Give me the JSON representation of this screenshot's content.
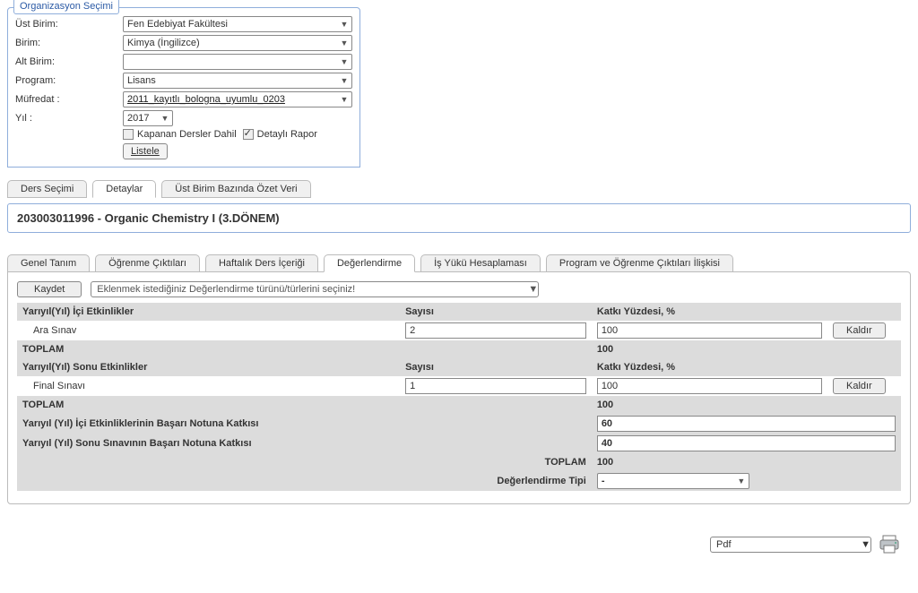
{
  "org": {
    "legend": "Organizasyon Seçimi",
    "labels": {
      "ust_birim": "Üst Birim:",
      "birim": "Birim:",
      "alt_birim": "Alt Birim:",
      "program": "Program:",
      "muferdat": "Müfredat :",
      "yil": "Yıl :"
    },
    "values": {
      "ust_birim": "Fen Edebiyat Fakültesi",
      "birim": "Kimya (İngilizce)",
      "alt_birim": "",
      "program": "Lisans",
      "muferdat": "2011_kayıtlı_bologna_uyumlu_0203",
      "yil": "2017"
    },
    "checks": {
      "kapanan": "Kapanan Dersler Dahil",
      "detayli": "Detaylı Rapor"
    },
    "listele": "Listele"
  },
  "main_tabs": {
    "ders": "Ders Seçimi",
    "detaylar": "Detaylar",
    "ust": "Üst Birim Bazında Özet Veri"
  },
  "course_title": "203003011996 - Organic Chemistry I (3.DÖNEM)",
  "sub_tabs": {
    "genel": "Genel Tanım",
    "ogrenme": "Öğrenme Çıktıları",
    "haftalik": "Haftalık Ders İçeriği",
    "degerlendirme": "Değerlendirme",
    "isyuku": "İş Yükü Hesaplaması",
    "program": "Program ve Öğrenme Çıktıları İlişkisi"
  },
  "save_btn": "Kaydet",
  "save_placeholder": "Eklenmek istediğiniz Değerlendirme türünü/türlerini seçiniz!",
  "headers": {
    "ici_etk": "Yarıyıl(Yıl) İçi Etkinlikler",
    "sayisi": "Sayısı",
    "katki": "Katkı Yüzdesi, %",
    "toplam": "TOPLAM",
    "sonu_etk": "Yarıyıl(Yıl) Sonu Etkinlikler",
    "ici_basari": "Yarıyıl (Yıl) İçi Etkinliklerinin Başarı Notuna Katkısı",
    "sonu_basari": "Yarıyıl (Yıl) Sonu Sınavının Başarı Notuna Katkısı",
    "deg_tipi": "Değerlendirme Tipi"
  },
  "rows": {
    "ara_sinav": {
      "name": "Ara Sınav",
      "sayi": "2",
      "katki": "100",
      "kaldir": "Kaldır"
    },
    "ici_toplam": "100",
    "final": {
      "name": "Final Sınavı",
      "sayi": "1",
      "katki": "100",
      "kaldir": "Kaldır"
    },
    "sonu_toplam": "100",
    "ici_basari_val": "60",
    "sonu_basari_val": "40",
    "genel_toplam": "100",
    "tipi_val": "-"
  },
  "footer": {
    "export": "Pdf"
  }
}
